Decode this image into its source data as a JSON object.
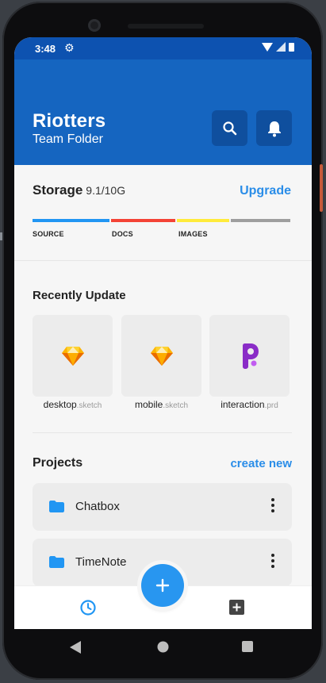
{
  "status_bar": {
    "time": "3:48"
  },
  "header": {
    "title": "Riotters",
    "subtitle": "Team Folder"
  },
  "storage": {
    "label": "Storage",
    "value": "9.1/10G",
    "upgrade_label": "Upgrade",
    "segments": [
      {
        "label": "SOURCE",
        "color": "#2196f3"
      },
      {
        "label": "DOCS",
        "color": "#f44336"
      },
      {
        "label": "IMAGES",
        "color": "#ffeb3b"
      },
      {
        "label": "",
        "color": "#9e9e9e"
      }
    ]
  },
  "recent": {
    "title": "Recently Update",
    "files": [
      {
        "name": "desktop",
        "ext": ".sketch",
        "icon": "sketch-icon"
      },
      {
        "name": "mobile",
        "ext": ".sketch",
        "icon": "sketch-icon"
      },
      {
        "name": "interaction",
        "ext": ".prd",
        "icon": "protopie-icon"
      }
    ]
  },
  "projects": {
    "title": "Projects",
    "create_label": "create new",
    "items": [
      {
        "name": "Chatbox",
        "icon": "folder-icon"
      },
      {
        "name": "TimeNote",
        "icon": "folder-icon"
      }
    ]
  },
  "colors": {
    "header": "#1565c0",
    "accent": "#2a8de8",
    "fab": "#2896f0"
  }
}
